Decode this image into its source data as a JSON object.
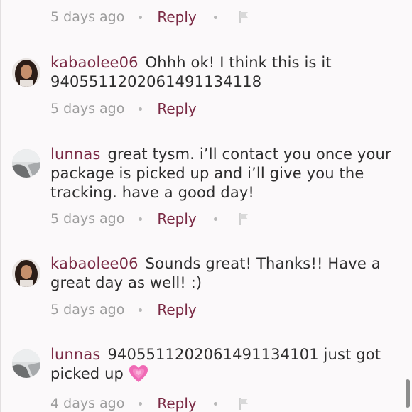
{
  "comments": [
    {
      "username": "",
      "text": "",
      "time": "5 days ago",
      "reply_label": "Reply",
      "show_flag": true
    },
    {
      "username": "kabaolee06",
      "text": "Ohhh ok! I think this is it 9405511202061491134118",
      "time": "5 days ago",
      "reply_label": "Reply",
      "show_flag": false
    },
    {
      "username": "lunnas",
      "text": "great tysm. i’ll contact you once your package is picked up and i’ll give you the tracking. have a good day!",
      "time": "5 days ago",
      "reply_label": "Reply",
      "show_flag": true
    },
    {
      "username": "kabaolee06",
      "text": "Sounds great! Thanks!! Have a great day as well! :)",
      "time": "5 days ago",
      "reply_label": "Reply",
      "show_flag": false
    },
    {
      "username": "lunnas",
      "text": "9405511202061491134101 just got picked up",
      "emoji": "growing-heart-icon",
      "time": "4 days ago",
      "reply_label": "Reply",
      "show_flag": true
    }
  ],
  "colors": {
    "username": "#7a2a44",
    "reply": "#7a2a44",
    "meta": "#9d9d9d",
    "body_text": "#2d2d2d",
    "heart": "#f06ab5"
  }
}
